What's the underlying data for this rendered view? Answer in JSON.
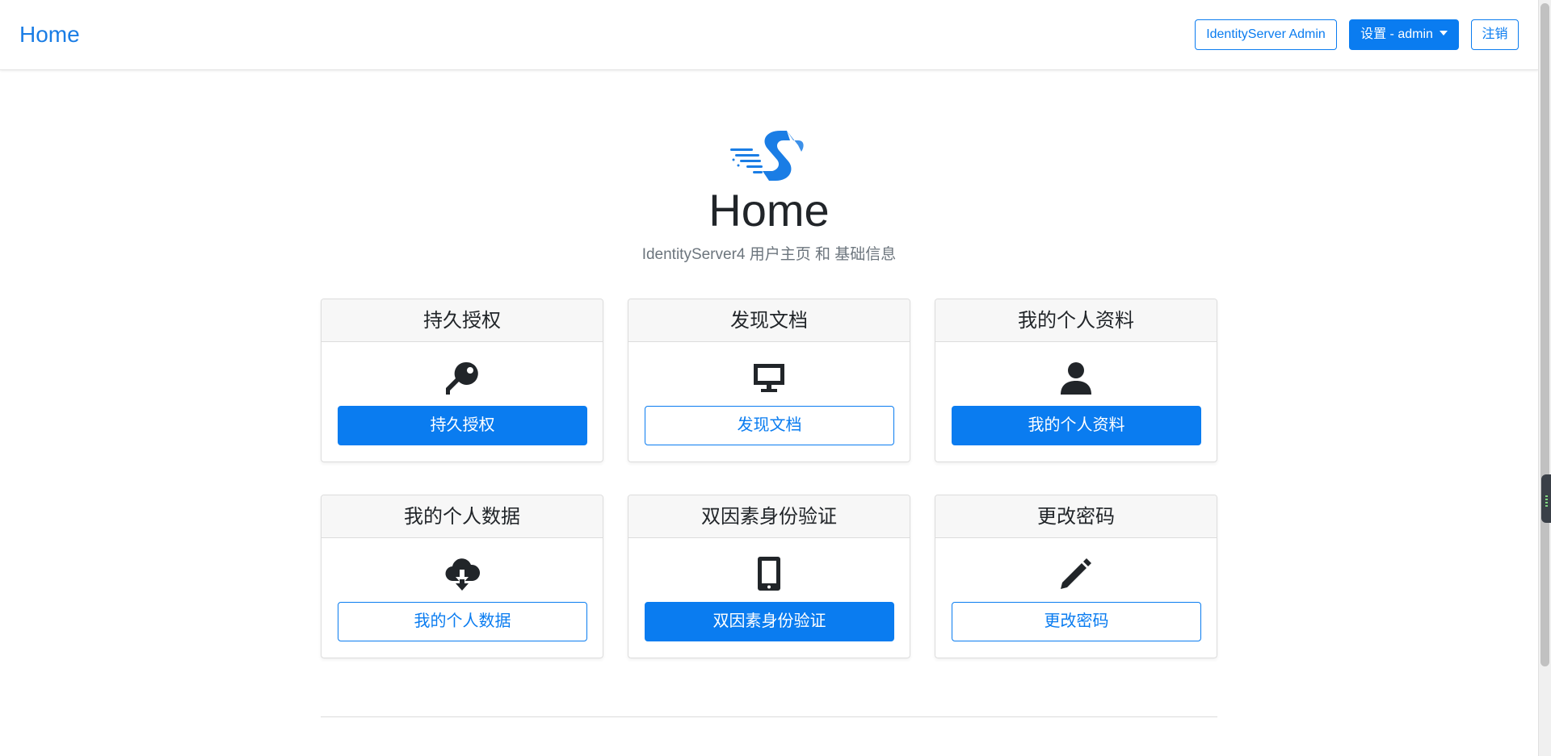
{
  "navbar": {
    "brand": "Home",
    "admin_label": "IdentityServer Admin",
    "settings_label": "设置 - admin",
    "logout_label": "注销"
  },
  "hero": {
    "title": "Home",
    "subtitle": "IdentityServer4 用户主页 和 基础信息"
  },
  "cards": [
    {
      "title": "持久授权",
      "button": "持久授权",
      "icon": "key-icon",
      "style": "solid"
    },
    {
      "title": "发现文档",
      "button": "发现文档",
      "icon": "monitor-icon",
      "style": "outline"
    },
    {
      "title": "我的个人资料",
      "button": "我的个人资料",
      "icon": "user-icon",
      "style": "solid"
    },
    {
      "title": "我的个人数据",
      "button": "我的个人数据",
      "icon": "cloud-download-icon",
      "style": "outline"
    },
    {
      "title": "双因素身份验证",
      "button": "双因素身份验证",
      "icon": "smartphone-icon",
      "style": "solid"
    },
    {
      "title": "更改密码",
      "button": "更改密码",
      "icon": "pencil-icon",
      "style": "outline"
    }
  ],
  "colors": {
    "primary": "#0a7cf0",
    "brand": "#1a7de5",
    "header_bg": "#f7f7f7",
    "subtitle": "#6c757d"
  }
}
